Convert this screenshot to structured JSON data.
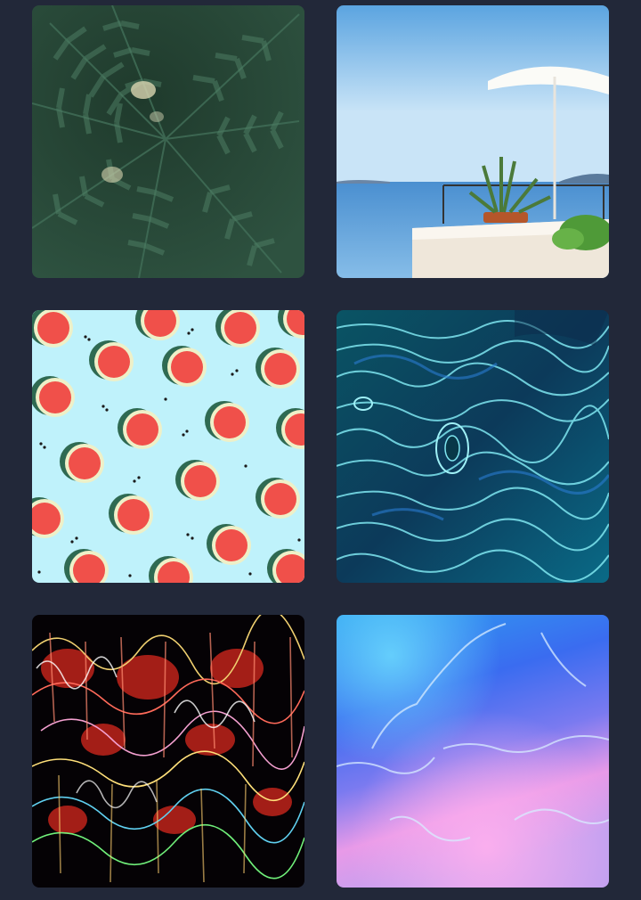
{
  "gallery": {
    "tiles": [
      {
        "name": "fern-leaves-image",
        "subject": "fern"
      },
      {
        "name": "seaside-terrace-image",
        "subject": "terrace"
      },
      {
        "name": "watermelon-pattern-image",
        "subject": "watermelon"
      },
      {
        "name": "teal-liquid-texture-image",
        "subject": "teal-waves"
      },
      {
        "name": "neon-light-trails-image",
        "subject": "light-trails"
      },
      {
        "name": "iridescent-foil-image",
        "subject": "holographic"
      }
    ],
    "colors": {
      "background": "#222839",
      "fern": "#2b4a3a",
      "sky": "#9ecbee",
      "watermelon_bg": "#bff2fb",
      "watermelon_flesh": "#f0504a",
      "teal": "#0b4a5c",
      "trails_bg": "#050205",
      "holo_blue": "#3a78f0",
      "holo_pink": "#f0a0e8"
    }
  }
}
